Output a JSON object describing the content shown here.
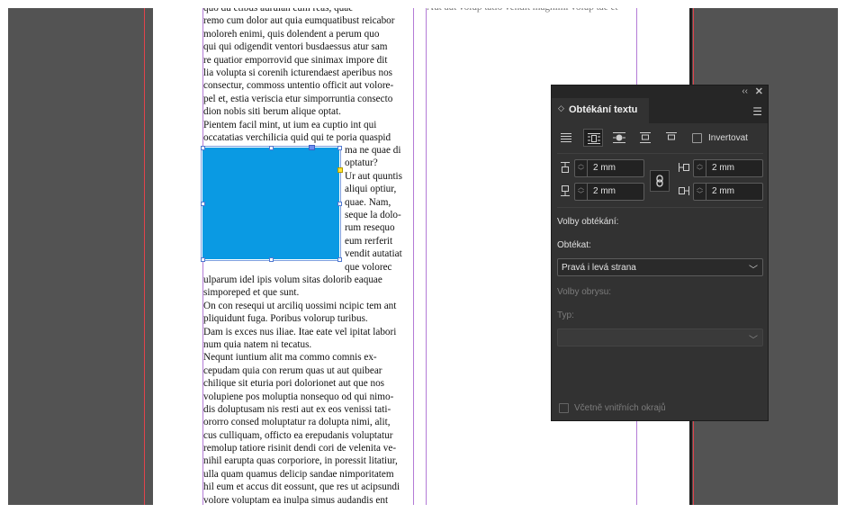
{
  "document": {
    "column_left_lines": [
      "quo du etlbus aurulan cum reas, quae",
      "remo cum dolor aut quia eumquatibust reicabor",
      "moloreh enimi, quis dolendent a perum quo",
      "qui qui odigendit ventori busdaessus atur sam",
      "re quatior emporrovid que sinimax impore dit",
      "lia volupta si corenih icturendaest aperibus nos",
      "consectur, commoss untentio officit aut volore-",
      "pel et, estia veriscia etur simporruntia consecto",
      "dion nobis siti berum alique optat.",
      "Pientem facil mint, ut ium ea cuptio int qui",
      "occatatias verchilicia quid qui te poria quaspid"
    ],
    "wrap_right_lines": [
      "ma ne quae di",
      "optatur?",
      "Ur aut quuntis",
      "aliqui optiur,",
      "quae. Nam,",
      "seque la dolo-",
      "rum resequo",
      "eum rerferit",
      "vendit autatiat",
      "que volorec"
    ],
    "column_left_bottom_lines": [
      "ulparum idel ipis volum sitas dolorib eaquae",
      "simporeped et que sunt.",
      "On con resequi ut arciliq uossimi ncipic tem ant",
      "pliquidunt fuga. Poribus volorup turibus.",
      "Dam is exces nus iliae. Itae eate vel ipitat labori",
      "num quia natem ni tecatus.",
      "Nequnt iuntium alit ma commo comnis ex-",
      "cepudam quia con rerum quas ut aut quibear",
      "chilique sit eturia pori dolorionet aut que nos",
      "volupiene pos moluptia nonsequo od qui nimo-",
      "dis doluptusam nis resti aut ex eos venissi tati-",
      "ororro consed moluptatur ra dolupta nimi, alit,",
      "cus culliquam, officto ea erepudanis voluptatur",
      "remolup tatiore risinit dendi cori de velenita ve-",
      "nihil earupta quas corporiore, in poressit litatiur,",
      "ulla quam quamus delicip sandae nimporitatem",
      "hil eum et accus dit eossunt, que res ut acipsundi",
      "volore voluptam ea inulpa simus audandis ent"
    ],
    "column_right_lines": [
      "Aut aut volup tatio vendit magnimi volup tae et"
    ],
    "frame_color": "#0a9ae3"
  },
  "panel": {
    "collapse_icon": "double-chevron-left-icon",
    "close_icon": "close-icon",
    "tab_title": "Obtékání textu",
    "menu_icon": "hamburger-menu-icon",
    "wrap_modes": [
      "no-wrap-icon",
      "wrap-bounding-box-icon",
      "wrap-object-shape-icon",
      "jump-object-icon",
      "jump-to-next-column-icon"
    ],
    "selected_wrap_mode": "wrap-bounding-box-icon",
    "invert_label": "Invertovat",
    "invert_checked": false,
    "offsets": {
      "top": "2 mm",
      "left": "2 mm",
      "bottom": "2 mm",
      "right": "2 mm"
    },
    "wrap_options_label": "Volby obtékání:",
    "wrap_to_label": "Obtékat:",
    "wrap_to_value": "Pravá i levá strana",
    "contour_options_label": "Volby obrysu:",
    "type_label": "Typ:",
    "type_value": "",
    "include_inside_edges_label": "Včetně vnitřních okrajů",
    "include_inside_edges_checked": false
  }
}
